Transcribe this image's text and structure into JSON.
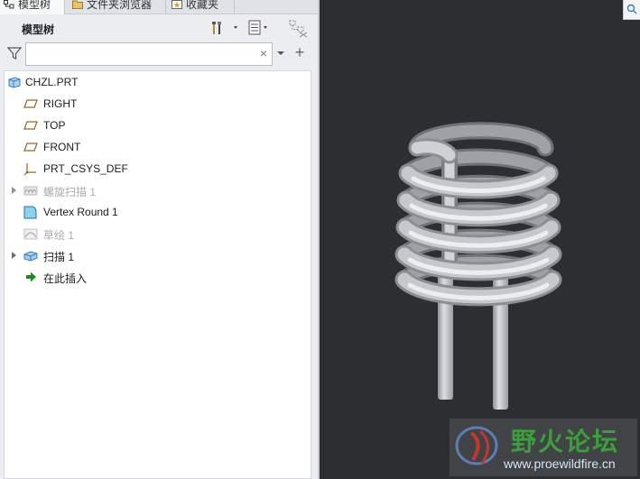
{
  "tabs": [
    {
      "label": "模型树",
      "icon": "model-tree-icon",
      "active": true
    },
    {
      "label": "文件夹浏览器",
      "icon": "folder-browser-icon",
      "active": false
    },
    {
      "label": "收藏夹",
      "icon": "favorites-icon",
      "active": false
    }
  ],
  "tree_header": {
    "title": "模型树"
  },
  "filter": {
    "value": "",
    "placeholder": "",
    "clear_glyph": "×",
    "add_glyph": "+"
  },
  "tree": [
    {
      "label": "CHZL.PRT",
      "icon": "part-icon",
      "dimmed": false,
      "expandable": false
    },
    {
      "label": "RIGHT",
      "icon": "datum-plane-icon",
      "dimmed": false,
      "expandable": false
    },
    {
      "label": "TOP",
      "icon": "datum-plane-icon",
      "dimmed": false,
      "expandable": false
    },
    {
      "label": "FRONT",
      "icon": "datum-plane-icon",
      "dimmed": false,
      "expandable": false
    },
    {
      "label": "PRT_CSYS_DEF",
      "icon": "coordinate-system-icon",
      "dimmed": false,
      "expandable": false
    },
    {
      "label": "螺旋扫描 1",
      "icon": "helical-sweep-icon",
      "dimmed": true,
      "expandable": true
    },
    {
      "label": "Vertex Round 1",
      "icon": "vertex-round-icon",
      "dimmed": false,
      "expandable": false
    },
    {
      "label": "草绘 1",
      "icon": "sketch-icon",
      "dimmed": true,
      "expandable": false
    },
    {
      "label": "扫描 1",
      "icon": "sweep-icon",
      "dimmed": false,
      "expandable": true
    },
    {
      "label": "在此插入",
      "icon": "insert-here-arrow-icon",
      "dimmed": false,
      "expandable": false
    }
  ],
  "watermark": {
    "title": "野火论坛",
    "url": "www.proewildfire.cn"
  },
  "colors": {
    "viewport_bg": "#2d2e31",
    "model": "#c6c9cc",
    "insert_arrow": "#1f8a1f",
    "watermark_green": "#3aa03a"
  }
}
